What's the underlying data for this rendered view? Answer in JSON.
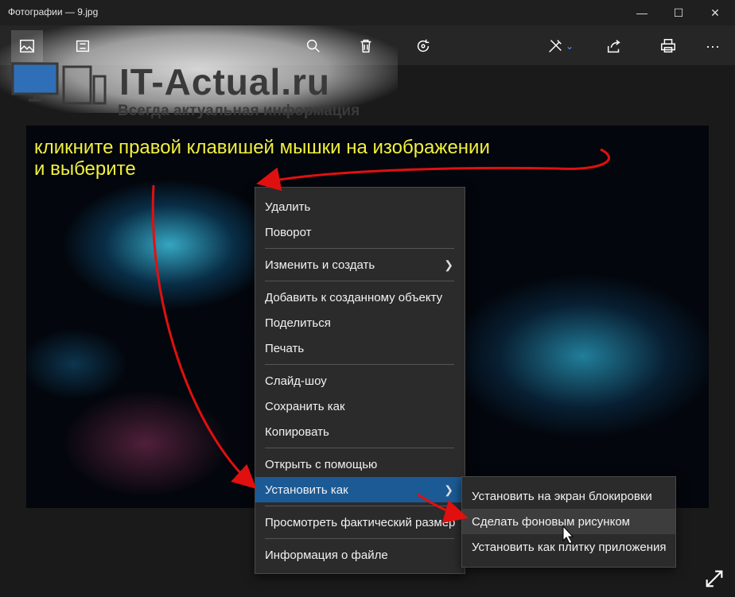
{
  "window": {
    "title": "Фотографии — 9.jpg"
  },
  "toolbar": {
    "buttons": [
      "collection-icon",
      "slideshow-icon",
      "zoom-icon",
      "delete-icon",
      "rotate-icon",
      "edit-create-icon",
      "share-icon",
      "print-icon",
      "more-icon"
    ],
    "more_label": "···"
  },
  "watermark": {
    "title": "IT-Actual.ru",
    "subtitle": "Всегда актуальная информация"
  },
  "annotation": {
    "line1": "кликните правой клавишей мышки на изображении",
    "line2": "и выберите"
  },
  "context_menu": {
    "items": [
      "Удалить",
      "Поворот",
      "Изменить и создать",
      "Добавить к созданному объекту",
      "Поделиться",
      "Печать",
      "Слайд-шоу",
      "Сохранить как",
      "Копировать",
      "Открыть с помощью",
      "Установить как",
      "Просмотреть фактический размер",
      "Информация о файле"
    ],
    "active_item": "Установить как"
  },
  "submenu": {
    "items": [
      "Установить на экран блокировки",
      "Сделать фоновым рисунком",
      "Установить как плитку приложения"
    ],
    "hovered_item": "Сделать фоновым рисунком"
  },
  "colors": {
    "accent": "#1b5a94",
    "annotation": "#f0f040",
    "arrow": "#e01010"
  }
}
